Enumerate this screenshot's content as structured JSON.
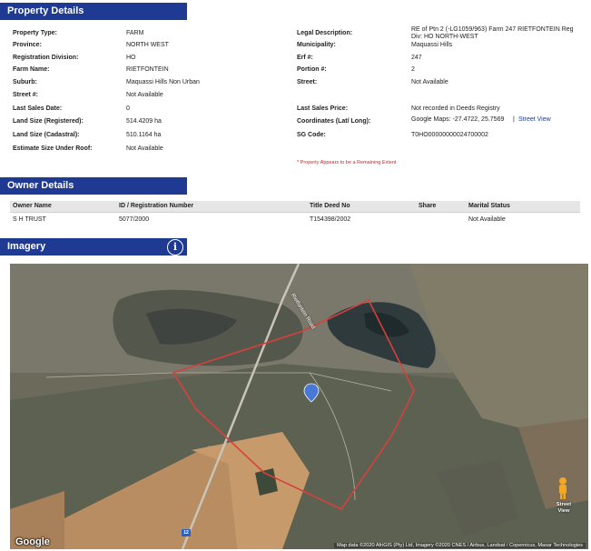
{
  "sections": {
    "property_details": "Property Details",
    "owner_details": "Owner Details",
    "imagery": "Imagery"
  },
  "property": {
    "left": [
      {
        "label": "Property Type:",
        "value": "FARM"
      },
      {
        "label": "Province:",
        "value": "NORTH WEST"
      },
      {
        "label": "Registration Division:",
        "value": "HO"
      },
      {
        "label": "Farm Name:",
        "value": "RIETFONTEIN"
      },
      {
        "label": "Suburb:",
        "value": "Maquassi Hills Non Urban"
      },
      {
        "label": "Street #:",
        "value": "Not Available"
      },
      {
        "label": "Last Sales Date:",
        "value": "0"
      },
      {
        "label": "Land Size (Registered):",
        "value": "514.4209 ha"
      },
      {
        "label": "Land Size (Cadastral):",
        "value": "510.1164 ha"
      },
      {
        "label": "Estimate Size Under Roof:",
        "value": "Not Available"
      }
    ],
    "right": {
      "legal_label": "Legal Description:",
      "legal_value_line1": "RE of Ptn 2 (-LG1059/963) Farm 247 RIETFONTEIN Reg",
      "legal_value_line2": "Div: HO NORTH-WEST",
      "municipality_label": "Municipality:",
      "municipality_value": "Maquassi Hills",
      "erf_label": "Erf #:",
      "erf_value": "247",
      "portion_label": "Portion #:",
      "portion_value": "2",
      "street_label": "Street:",
      "street_value": "Not Available",
      "last_price_label": "Last Sales Price:",
      "last_price_value": "Not recorded in Deeds Registry",
      "coords_label": "Coordinates (Lat/ Long):",
      "coords_value": "Google Maps: -27.4722, 25.7569",
      "coords_separator": "|",
      "street_view_link": "Street View",
      "sg_label": "SG Code:",
      "sg_value": "T0HO00000000024700002"
    },
    "remark": "* Property Appears to be a Remaining Extent"
  },
  "owners": {
    "headers": [
      "Owner Name",
      "ID / Registration Number",
      "Title Deed No",
      "Share",
      "Marital Status"
    ],
    "rows": [
      {
        "name": "S H TRUST",
        "id": "5077/2000",
        "deed": "T154398/2002",
        "share": "",
        "marital": "Not Available"
      }
    ]
  },
  "imagery": {
    "info_icon": "info-icon",
    "info_glyph": "i",
    "google_logo": "Google",
    "attribution": "Map data ©2020 AfriGIS (Pty) Ltd, Imagery ©2020 CNES / Airbus, Landsat / Copernicus, Maxar Technologies",
    "street_view_label_line1": "Street",
    "street_view_label_line2": "View",
    "road_label": "Rietfontein Road",
    "route_shield": "12",
    "boundary_color": "#d8403c",
    "pin_color": "#4a78d6"
  }
}
